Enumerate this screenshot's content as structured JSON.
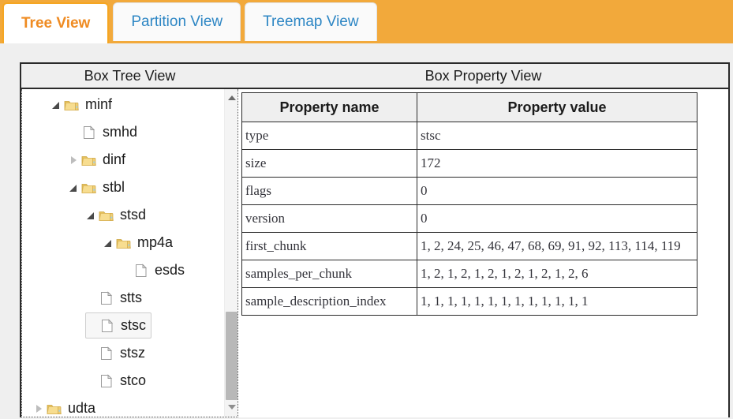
{
  "tabs": [
    {
      "label": "Tree View",
      "active": true
    },
    {
      "label": "Partition View",
      "active": false
    },
    {
      "label": "Treemap View",
      "active": false
    }
  ],
  "panels": {
    "tree_header": "Box Tree View",
    "property_header": "Box Property View"
  },
  "tree": {
    "nodes": [
      {
        "label": "minf",
        "icon": "folder-icon",
        "twisty": "expanded",
        "depth": 3,
        "selected": false
      },
      {
        "label": "smhd",
        "icon": "file-icon",
        "twisty": "none",
        "depth": 4,
        "selected": false
      },
      {
        "label": "dinf",
        "icon": "folder-icon",
        "twisty": "collapsed",
        "depth": 4,
        "selected": false
      },
      {
        "label": "stbl",
        "icon": "folder-icon",
        "twisty": "expanded",
        "depth": 4,
        "selected": false
      },
      {
        "label": "stsd",
        "icon": "folder-icon",
        "twisty": "expanded",
        "depth": 5,
        "selected": false
      },
      {
        "label": "mp4a",
        "icon": "folder-icon",
        "twisty": "expanded",
        "depth": 6,
        "selected": false
      },
      {
        "label": "esds",
        "icon": "file-icon",
        "twisty": "none",
        "depth": 7,
        "selected": false
      },
      {
        "label": "stts",
        "icon": "file-icon",
        "twisty": "none",
        "depth": 5,
        "selected": false
      },
      {
        "label": "stsc",
        "icon": "file-icon",
        "twisty": "none",
        "depth": 5,
        "selected": true
      },
      {
        "label": "stsz",
        "icon": "file-icon",
        "twisty": "none",
        "depth": 5,
        "selected": false
      },
      {
        "label": "stco",
        "icon": "file-icon",
        "twisty": "none",
        "depth": 5,
        "selected": false
      },
      {
        "label": "udta",
        "icon": "folder-icon",
        "twisty": "collapsed",
        "depth": 2,
        "selected": false
      }
    ],
    "scroll": {
      "thumb_top_pct": 68,
      "thumb_height_pct": 27
    }
  },
  "property_table": {
    "columns": [
      "Property name",
      "Property value"
    ],
    "rows": [
      {
        "name": "type",
        "value": "stsc"
      },
      {
        "name": "size",
        "value": "172"
      },
      {
        "name": "flags",
        "value": "0"
      },
      {
        "name": "version",
        "value": "0"
      },
      {
        "name": "first_chunk",
        "value": "1, 2, 24, 25, 46, 47, 68, 69, 91, 92, 113, 114, 119"
      },
      {
        "name": "samples_per_chunk",
        "value": "1, 2, 1, 2, 1, 2, 1, 2, 1, 2, 1, 2, 6"
      },
      {
        "name": "sample_description_index",
        "value": "1, 1, 1, 1, 1, 1, 1, 1, 1, 1, 1, 1, 1"
      }
    ]
  },
  "colors": {
    "tabbar_bg": "#f2a93b",
    "active_tab_text": "#ef8b22",
    "inactive_tab_text": "#2d86c4",
    "header_bg": "#efefef",
    "folder": "#f2d37a",
    "frame_border": "#2a2a2a"
  }
}
